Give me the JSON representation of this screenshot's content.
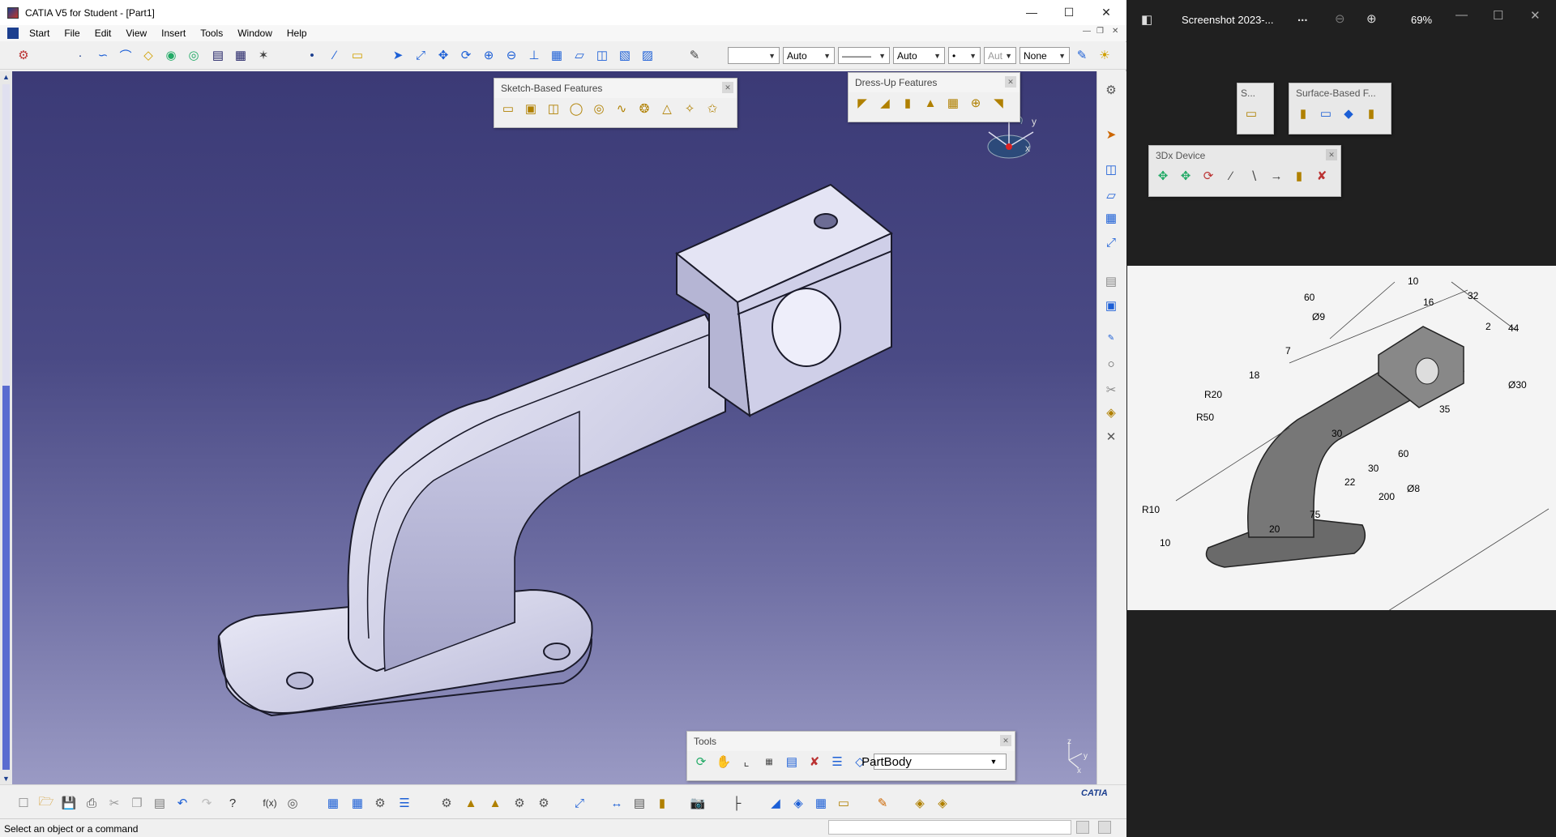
{
  "catia": {
    "title": "CATIA V5 for Student - [Part1]",
    "menu": [
      "Start",
      "File",
      "Edit",
      "View",
      "Insert",
      "Tools",
      "Window",
      "Help"
    ],
    "selects": {
      "color": "",
      "transparency": "Auto",
      "linetype": "———",
      "thickness": "Auto",
      "point": "•",
      "layer_aut": "Aut",
      "layer": "None"
    },
    "sketch_toolbar_title": "Sketch-Based Features",
    "dressup_toolbar_title": "Dress-Up Features",
    "tools_toolbar_title": "Tools",
    "tools_body": "PartBody",
    "status": "Select an object or a command",
    "logo": "CATIA",
    "compass_labels": {
      "y": "y",
      "x": "x",
      "z": "z"
    },
    "axis_labels": {
      "z": "z",
      "y": "y",
      "x": "x"
    }
  },
  "photos": {
    "title": "Screenshot 2023-...",
    "zoom": "69%",
    "more": "...",
    "toolbars": {
      "s": "S...",
      "surface": "Surface-Based F...",
      "device": "3Dx Device"
    },
    "dimensions": [
      "10",
      "60",
      "16",
      "32",
      "Ø9",
      "2",
      "44",
      "7",
      "18",
      "R20",
      "R50",
      "Ø30",
      "35",
      "30",
      "60",
      "30",
      "22",
      "Ø8",
      "R10",
      "200",
      "75",
      "20",
      "10"
    ]
  },
  "colors": {
    "viewport_top": "#3b3a76",
    "viewport_bottom": "#9a9ac4",
    "part_fill": "#d9d9ef",
    "accent_blue": "#1c5fd6"
  }
}
